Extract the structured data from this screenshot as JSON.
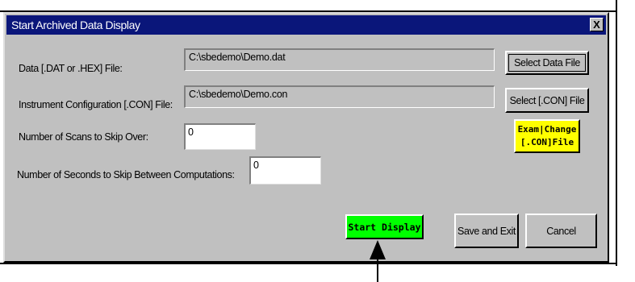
{
  "dialog": {
    "title": "Start Archived Data Display",
    "close_label": "X"
  },
  "data_file": {
    "label": "Data [.DAT or .HEX] File:",
    "value": "C:\\sbedemo\\Demo.dat",
    "button": "Select Data File"
  },
  "config_file": {
    "label": "Instrument Configuration [.CON] File:",
    "value": "C:\\sbedemo\\Demo.con",
    "button": "Select [.CON] File"
  },
  "exam_button": {
    "line1": "Exam|Change",
    "line2": "[.CON]File"
  },
  "scans_skip": {
    "label": "Number of Scans to Skip Over:",
    "value": "0"
  },
  "seconds_skip": {
    "label": "Number of Seconds to Skip Between Computations:",
    "value": "0"
  },
  "actions": {
    "start": "Start Display",
    "save_exit": "Save and Exit",
    "cancel": "Cancel"
  },
  "colors": {
    "titlebar": "#0a167a",
    "dialog_bg": "#c0c0c0",
    "start_button": "#00ff00",
    "exam_button": "#ffff00"
  }
}
